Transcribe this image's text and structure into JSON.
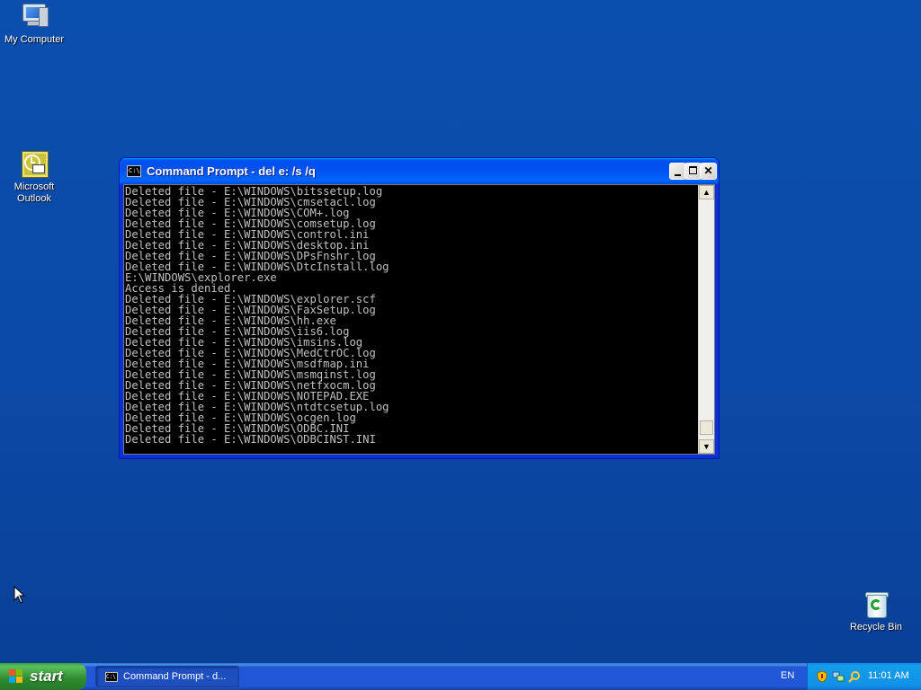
{
  "desktop": {
    "icons": [
      {
        "label": "My Computer"
      },
      {
        "label": "Microsoft Outlook"
      },
      {
        "label": "Recycle Bin"
      }
    ]
  },
  "cmd_window": {
    "title": "Command Prompt - del e: /s /q",
    "title_icon": "C:\\",
    "lines": [
      "Deleted file - E:\\WINDOWS\\bitssetup.log",
      "Deleted file - E:\\WINDOWS\\cmsetacl.log",
      "Deleted file - E:\\WINDOWS\\COM+.log",
      "Deleted file - E:\\WINDOWS\\comsetup.log",
      "Deleted file - E:\\WINDOWS\\control.ini",
      "Deleted file - E:\\WINDOWS\\desktop.ini",
      "Deleted file - E:\\WINDOWS\\DPsFnshr.log",
      "Deleted file - E:\\WINDOWS\\DtcInstall.log",
      "E:\\WINDOWS\\explorer.exe",
      "Access is denied.",
      "Deleted file - E:\\WINDOWS\\explorer.scf",
      "Deleted file - E:\\WINDOWS\\FaxSetup.log",
      "Deleted file - E:\\WINDOWS\\hh.exe",
      "Deleted file - E:\\WINDOWS\\iis6.log",
      "Deleted file - E:\\WINDOWS\\imsins.log",
      "Deleted file - E:\\WINDOWS\\MedCtrOC.log",
      "Deleted file - E:\\WINDOWS\\msdfmap.ini",
      "Deleted file - E:\\WINDOWS\\msmqinst.log",
      "Deleted file - E:\\WINDOWS\\netfxocm.log",
      "Deleted file - E:\\WINDOWS\\NOTEPAD.EXE",
      "Deleted file - E:\\WINDOWS\\ntdtcsetup.log",
      "Deleted file - E:\\WINDOWS\\ocgen.log",
      "Deleted file - E:\\WINDOWS\\ODBC.INI",
      "Deleted file - E:\\WINDOWS\\ODBCINST.INI"
    ]
  },
  "taskbar": {
    "start_label": "start",
    "tasks": [
      {
        "label": "Command Prompt - d..."
      }
    ],
    "language": "EN",
    "clock": "11:01 AM"
  },
  "icons": {
    "cmd": "cmd-icon",
    "minimize": "minimize-icon",
    "maximize": "maximize-icon",
    "close": "close-icon",
    "cursor": "mouse-pointer-icon",
    "tray": [
      "security-shield-icon",
      "network-icon",
      "search-icon"
    ]
  }
}
